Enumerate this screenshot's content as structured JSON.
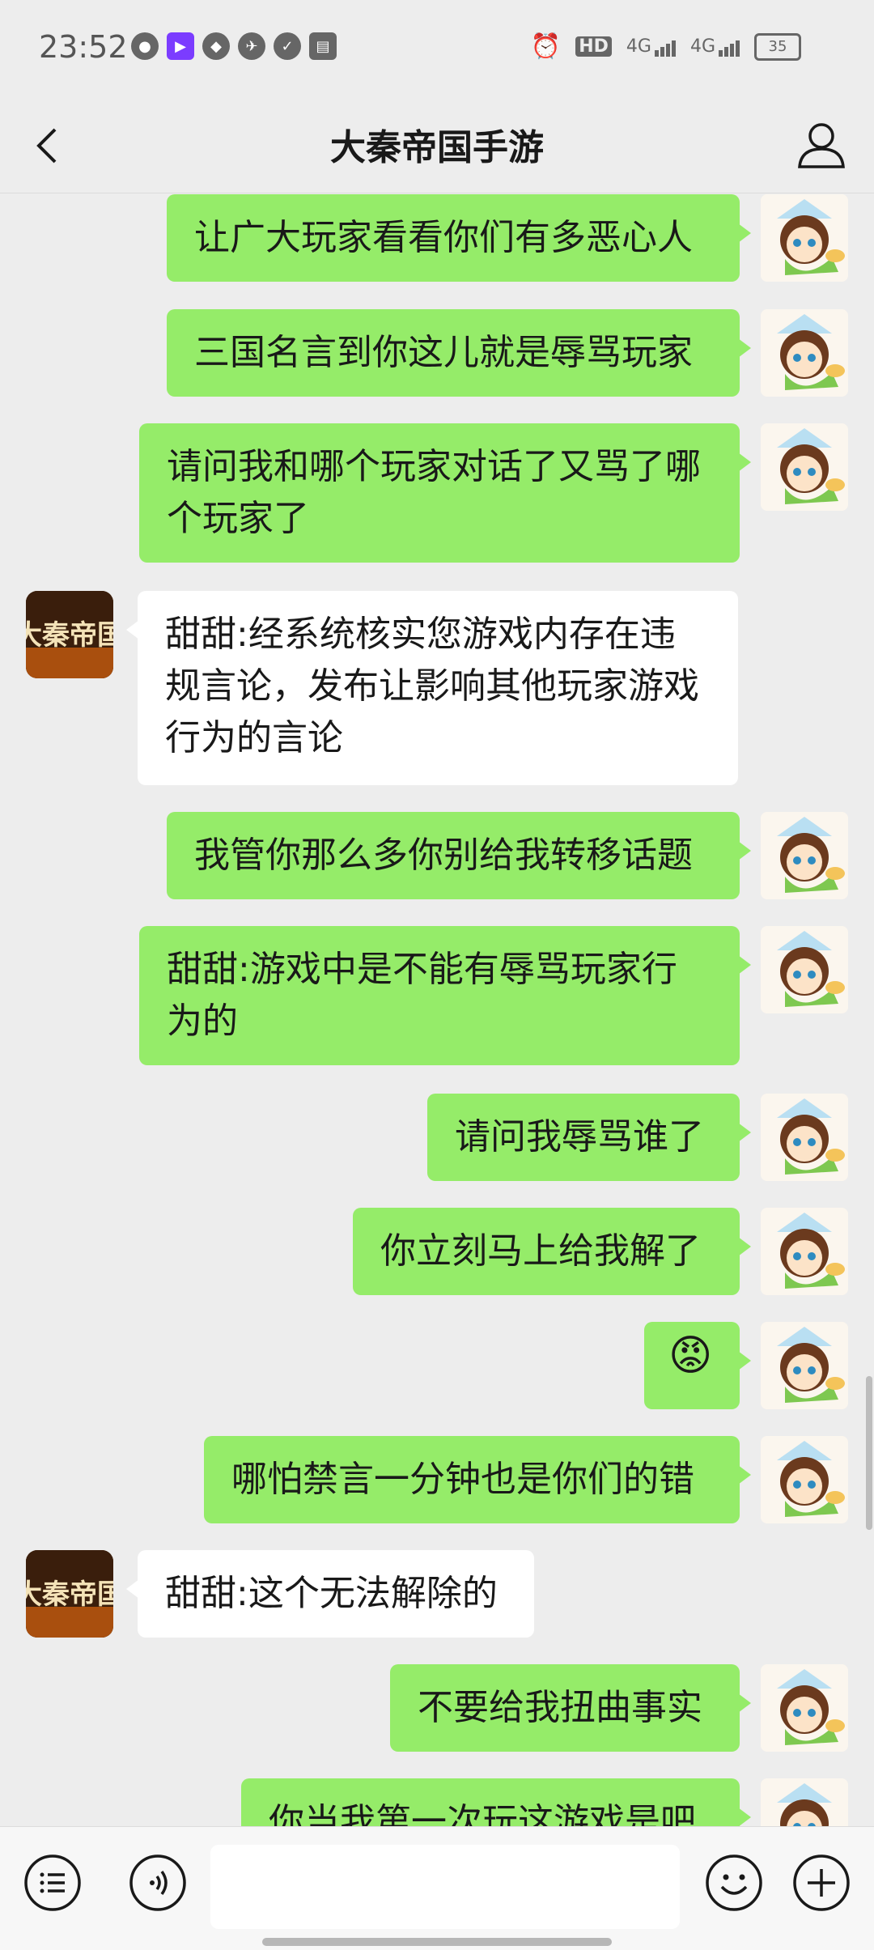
{
  "status_bar": {
    "time": "23:52",
    "hd": "HD",
    "net1": "4G",
    "net2": "4G",
    "battery": "35"
  },
  "header": {
    "title": "大秦帝国手游"
  },
  "messages": [
    {
      "from": "me",
      "text": "让广大玩家看看你们有多恶心人"
    },
    {
      "from": "me",
      "text": "三国名言到你这儿就是辱骂玩家"
    },
    {
      "from": "me",
      "text": "请问我和哪个玩家对话了又骂了哪\n个玩家了"
    },
    {
      "from": "sys",
      "text": "甜甜:经系统核实您游戏内存在违\n规言论，发布让影响其他玩家游戏\n行为的言论"
    },
    {
      "from": "me",
      "text": "我管你那么多你别给我转移话题"
    },
    {
      "from": "me",
      "text": "甜甜:游戏中是不能有辱骂玩家行\n为的"
    },
    {
      "from": "me",
      "text": "请问我辱骂谁了"
    },
    {
      "from": "me",
      "text": "你立刻马上给我解了"
    },
    {
      "from": "me",
      "text": "😡"
    },
    {
      "from": "me",
      "text": "哪怕禁言一分钟也是你们的错"
    },
    {
      "from": "sys",
      "text": "甜甜:这个无法解除的"
    },
    {
      "from": "me",
      "text": "不要给我扭曲事实"
    },
    {
      "from": "me",
      "text": "你当我第一次玩这游戏是吧"
    }
  ],
  "sys_avatar_text": "大秦帝国",
  "colors": {
    "my_bubble": "#95ec69",
    "sys_bubble": "#ffffff",
    "background": "#ededed"
  }
}
